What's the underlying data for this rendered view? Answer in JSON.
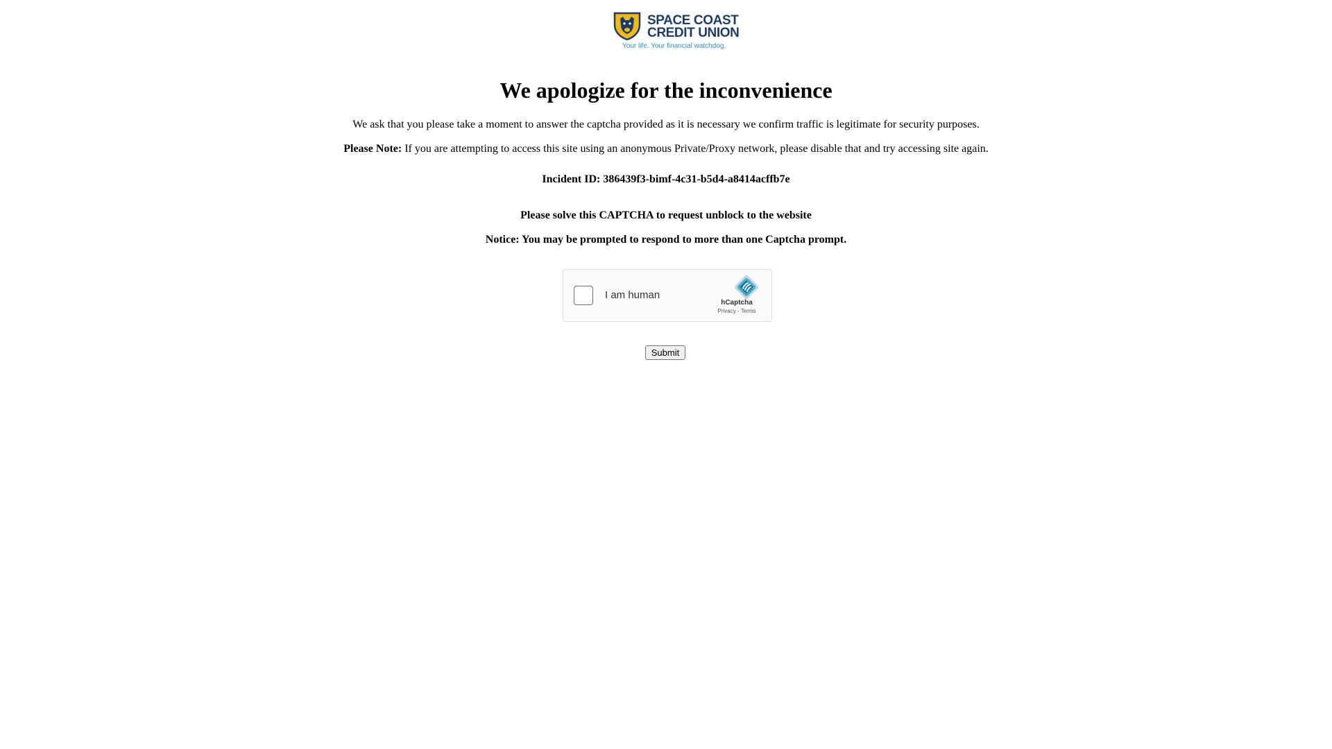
{
  "logo": {
    "line1": "SPACE COAST",
    "line2": "CREDIT UNION",
    "tagline": "Your life. Your financial watchdog.",
    "primary_color": "#1d3c6e",
    "accent_color": "#f2b719",
    "tagline_color": "#2a8fd0"
  },
  "heading": "We apologize for the inconvenience",
  "message": "We ask that you please take a moment to answer the captcha provided as it is necessary we confirm traffic is legitimate for security purposes.",
  "note": {
    "label": "Please Note:",
    "text": " If you are attempting to access this site using an anonymous Private/Proxy network, please disable that and try accessing site again."
  },
  "incident": "Incident ID: 386439f3-bimf-4c31-b5d4-a8414acffb7e",
  "captcha_prompt": "Please solve this CAPTCHA to request unblock to the website",
  "captcha_notice": "Notice: You may be prompted to respond to more than one Captcha prompt.",
  "captcha_widget": {
    "label": "I am human",
    "brand": "hCaptcha",
    "privacy": "Privacy",
    "separator": " - ",
    "terms": "Terms",
    "checked": false,
    "icon": "hcaptcha-logo-icon",
    "brand_color": "#0074bf",
    "accent_color": "#00838f"
  },
  "submit_label": "Submit"
}
